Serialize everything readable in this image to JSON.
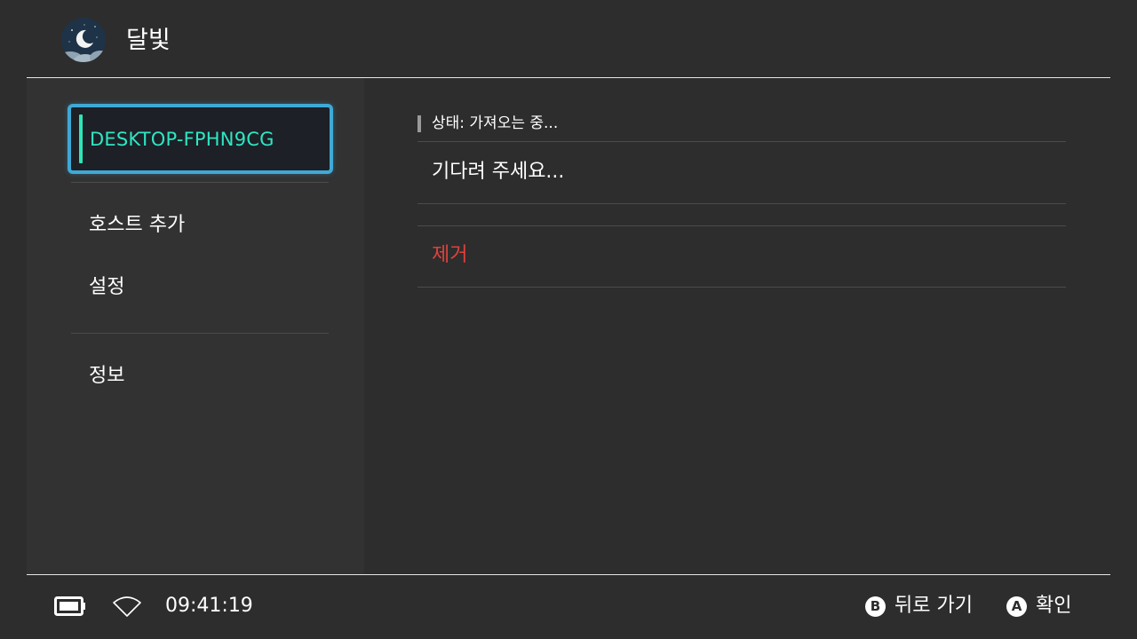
{
  "header": {
    "title": "달빛",
    "app_icon": "moon-app-icon"
  },
  "sidebar": {
    "hosts": [
      {
        "name": "DESKTOP-FPHN9CG",
        "selected": true
      }
    ],
    "items": [
      {
        "label": "호스트 추가"
      },
      {
        "label": "설정"
      },
      {
        "label": "정보"
      }
    ]
  },
  "main": {
    "status": "상태: 가져오는 중...",
    "wait_message": "기다려 주세요...",
    "remove_label": "제거"
  },
  "footer": {
    "time": "09:41:19",
    "battery_icon": "battery-icon",
    "wifi_icon": "wifi-icon",
    "hints": [
      {
        "button": "B",
        "label": "뒤로 가기"
      },
      {
        "button": "A",
        "label": "확인"
      }
    ]
  },
  "colors": {
    "background": "#2d2d2d",
    "sidebar": "#323232",
    "selection_border": "#3fa9d6",
    "selection_text": "#2ee6c4",
    "danger": "#e0413b"
  }
}
